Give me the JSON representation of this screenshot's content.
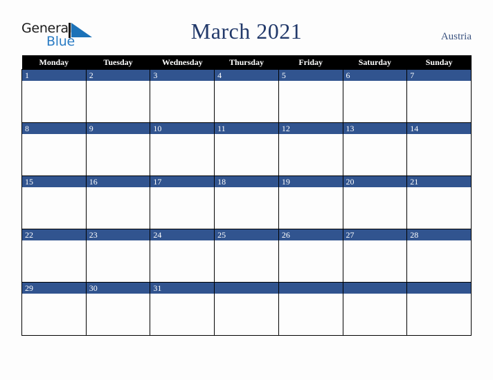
{
  "brand": {
    "line1": "General",
    "line2": "Blue",
    "mark_icon": "triangle-logo-icon",
    "color_dark": "#1b1b1b",
    "color_blue": "#2b7cc4"
  },
  "header": {
    "title": "March 2021",
    "country": "Austria",
    "title_color": "#22396a",
    "country_color": "#3c5480"
  },
  "calendar": {
    "header_bg": "#000000",
    "header_fg": "#ffffff",
    "bar_color": "#31548f",
    "cell_bg": "#fdfdfd",
    "grid_color": "#000000",
    "weekdays": [
      "Monday",
      "Tuesday",
      "Wednesday",
      "Thursday",
      "Friday",
      "Saturday",
      "Sunday"
    ],
    "weeks": [
      [
        "1",
        "2",
        "3",
        "4",
        "5",
        "6",
        "7"
      ],
      [
        "8",
        "9",
        "10",
        "11",
        "12",
        "13",
        "14"
      ],
      [
        "15",
        "16",
        "17",
        "18",
        "19",
        "20",
        "21"
      ],
      [
        "22",
        "23",
        "24",
        "25",
        "26",
        "27",
        "28"
      ],
      [
        "29",
        "30",
        "31",
        "",
        "",
        "",
        ""
      ]
    ]
  }
}
